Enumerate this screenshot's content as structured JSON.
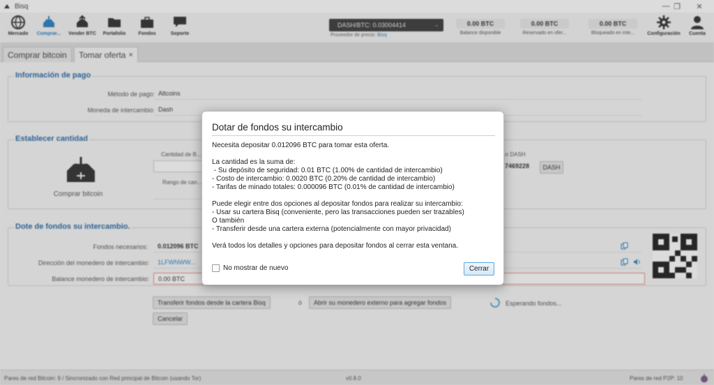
{
  "window": {
    "title": "Bisq",
    "minimize": "—",
    "maximize": "❐",
    "close": "✕"
  },
  "toolbar": {
    "nav": [
      {
        "label": "Mercado",
        "icon": "market-globe-icon"
      },
      {
        "label": "Comprar...",
        "icon": "buy-btc-icon"
      },
      {
        "label": "Vender BTC",
        "icon": "sell-btc-icon"
      },
      {
        "label": "Portafolio",
        "icon": "portfolio-folder-icon"
      },
      {
        "label": "Fondos",
        "icon": "funds-briefcase-icon"
      },
      {
        "label": "Soporte",
        "icon": "support-chat-icon"
      }
    ],
    "price": {
      "text": "DASH/BTC: 0.03004414",
      "provider_label": "Proveedor de precio:",
      "provider": "Bisq"
    },
    "balances": [
      {
        "value": "0.00 BTC",
        "caption": "Balance disponible"
      },
      {
        "value": "0.00 BTC",
        "caption": "Reservado en ofer..."
      },
      {
        "value": "0.00 BTC",
        "caption": "Bloqueado en inte..."
      }
    ],
    "settings_label": "Configuración",
    "account_label": "Cuenta"
  },
  "tabs": [
    {
      "label": "Comprar bitcoin"
    },
    {
      "label": "Tomar oferta",
      "close": "×"
    }
  ],
  "payment_info": {
    "title": "Información de pago",
    "method_label": "Método de pago:",
    "method_value": "Altcoins",
    "currency_label": "Moneda de intercambio:",
    "currency_value": "Dash"
  },
  "amount": {
    "title": "Establecer cantidad",
    "buy_label": "Comprar bitcoin",
    "amount_label": "Cantidad de B...",
    "range_label": "Rango de can...",
    "right_label": "...n DASH",
    "right_value": "7469228",
    "right_currency": "DASH"
  },
  "funding": {
    "title": "Dote de fondos su intercambio.",
    "needed_label": "Fondos necesarios:",
    "needed_value": "0.012096 BTC",
    "address_label": "Dirección del monedero de intercambio:",
    "address_value": "1LFWNWW...",
    "balance_label": "Balance monedero de intercambio:",
    "balance_value": "0.00 BTC",
    "transfer_button": "Transferir fondos desde la cartera Bisq",
    "or_text": "ó",
    "external_button": "Abrir su monedero externo para agregar fondos",
    "waiting_text": "Esperando fondos...",
    "cancel_button": "Cancelar"
  },
  "status": {
    "left": "Pares de red Bitcoin: 9 / Sincronizado con Red principal de Bitcoin (usando Tor)",
    "version": "v0.8.0",
    "right": "Pares de red P2P: 10"
  },
  "modal": {
    "title": "Dotar de fondos su intercambio",
    "lines": [
      "Necesita depositar 0.012096 BTC para tomar esta oferta.",
      "La cantidad es la suma de:",
      " - Su depósito de seguridad: 0.01 BTC (1.00% de cantidad de intercambio)",
      "- Costo de intercambio: 0.0020 BTC (0.20% de cantidad de intercambio)",
      "- Tarifas de minado totales: 0.000096 BTC (0.01% de cantidad de intercambio)",
      "Puede elegir entre dos opciones al depositar fondos para realizar su intercambio:",
      "- Usar su cartera Bisq (conveniente, pero las transacciones pueden ser trazables)",
      "O también",
      "- Transferir desde una cartera externa (potencialmente con mayor privacidad)",
      "Verá todos los detalles y opciones para depositar fondos al cerrar esta ventana."
    ],
    "checkbox_label": "No mostrar de nuevo",
    "close_button": "Cerrar"
  },
  "colors": {
    "accent": "#2a82c4",
    "section_title": "#2a6aa8",
    "error_border": "#e98c7a"
  }
}
